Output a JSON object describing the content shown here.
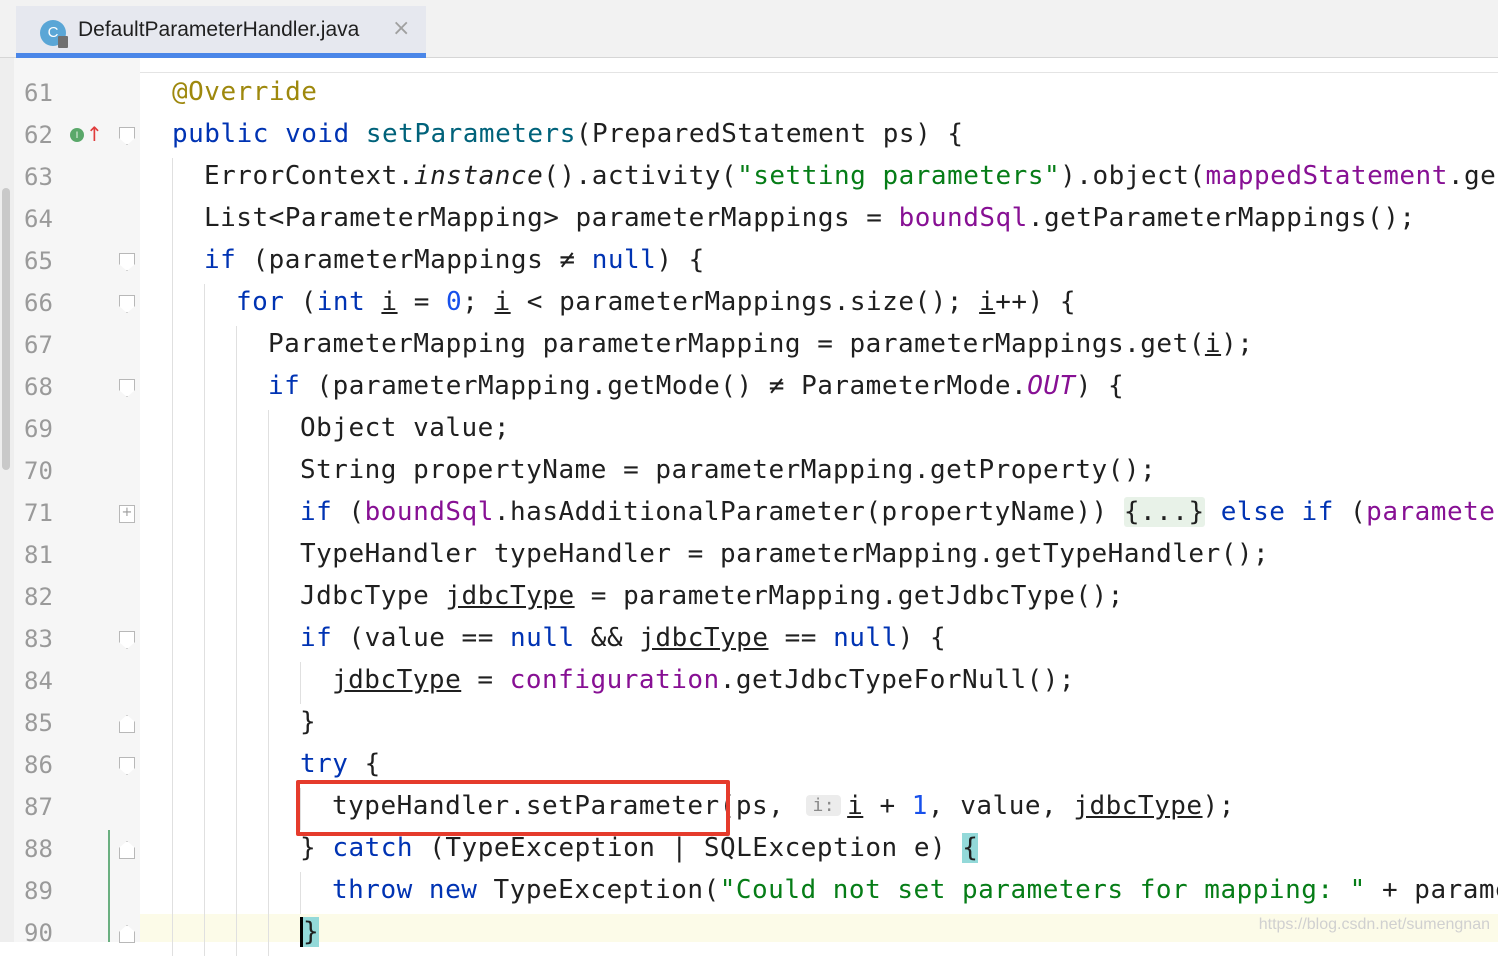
{
  "tab": {
    "file_icon_letter": "C",
    "title": "DefaultParameterHandler.java",
    "close": "×"
  },
  "gutter": {
    "impl_icon": "I",
    "up_arrow": "↑"
  },
  "code_lines": [
    {
      "ln": "61",
      "tokens": [
        {
          "t": "@Override",
          "c": "ann"
        }
      ]
    },
    {
      "ln": "62",
      "tokens": [
        {
          "t": "public ",
          "c": "kw"
        },
        {
          "t": "void ",
          "c": "kw"
        },
        {
          "t": "setParameters",
          "c": "method"
        },
        {
          "t": "(PreparedStatement ps) {",
          "c": ""
        }
      ]
    },
    {
      "ln": "63",
      "tokens": [
        {
          "t": "ErrorContext.",
          "c": ""
        },
        {
          "t": "instance",
          "c": "it"
        },
        {
          "t": "().activity(",
          "c": ""
        },
        {
          "t": "\"setting parameters\"",
          "c": "str"
        },
        {
          "t": ").object(",
          "c": ""
        },
        {
          "t": "mappedStatement",
          "c": "fld"
        },
        {
          "t": ".get",
          "c": ""
        }
      ]
    },
    {
      "ln": "64",
      "tokens": [
        {
          "t": "List<ParameterMapping> parameterMappings = ",
          "c": ""
        },
        {
          "t": "boundSql",
          "c": "fld"
        },
        {
          "t": ".getParameterMappings();",
          "c": ""
        }
      ]
    },
    {
      "ln": "65",
      "tokens": [
        {
          "t": "if ",
          "c": "kw"
        },
        {
          "t": "(parameterMappings ≠ ",
          "c": ""
        },
        {
          "t": "null",
          "c": "kw"
        },
        {
          "t": ") {",
          "c": ""
        }
      ]
    },
    {
      "ln": "66",
      "tokens": [
        {
          "t": "for ",
          "c": "kw"
        },
        {
          "t": "(",
          "c": ""
        },
        {
          "t": "int ",
          "c": "kw"
        },
        {
          "t": "i",
          "c": "ul"
        },
        {
          "t": " = ",
          "c": ""
        },
        {
          "t": "0",
          "c": "num"
        },
        {
          "t": "; ",
          "c": ""
        },
        {
          "t": "i",
          "c": "ul"
        },
        {
          "t": " < parameterMappings.size(); ",
          "c": ""
        },
        {
          "t": "i",
          "c": "ul"
        },
        {
          "t": "++) {",
          "c": ""
        }
      ]
    },
    {
      "ln": "67",
      "tokens": [
        {
          "t": "ParameterMapping parameterMapping = parameterMappings.get(",
          "c": ""
        },
        {
          "t": "i",
          "c": "ul"
        },
        {
          "t": ");",
          "c": ""
        }
      ]
    },
    {
      "ln": "68",
      "tokens": [
        {
          "t": "if ",
          "c": "kw"
        },
        {
          "t": "(parameterMapping.getMode() ≠ ParameterMode.",
          "c": ""
        },
        {
          "t": "OUT",
          "c": "itfld"
        },
        {
          "t": ") {",
          "c": ""
        }
      ]
    },
    {
      "ln": "69",
      "tokens": [
        {
          "t": "Object value;",
          "c": ""
        }
      ]
    },
    {
      "ln": "70",
      "tokens": [
        {
          "t": "String propertyName = parameterMapping.getProperty();",
          "c": ""
        }
      ]
    },
    {
      "ln": "71",
      "tokens": [
        {
          "t": "if ",
          "c": "kw"
        },
        {
          "t": "(",
          "c": ""
        },
        {
          "t": "boundSql",
          "c": "fld"
        },
        {
          "t": ".hasAdditionalParameter(propertyName)) ",
          "c": ""
        },
        {
          "t": "{...}",
          "c": "foldinline"
        },
        {
          "t": " ",
          "c": ""
        },
        {
          "t": "else if ",
          "c": "kw"
        },
        {
          "t": "(",
          "c": ""
        },
        {
          "t": "parameter",
          "c": "fld"
        }
      ]
    },
    {
      "ln": "81",
      "tokens": [
        {
          "t": "TypeHandler typeHandler = parameterMapping.getTypeHandler();",
          "c": ""
        }
      ]
    },
    {
      "ln": "82",
      "tokens": [
        {
          "t": "JdbcType ",
          "c": ""
        },
        {
          "t": "jdbcType",
          "c": "ul"
        },
        {
          "t": " = parameterMapping.getJdbcType();",
          "c": ""
        }
      ]
    },
    {
      "ln": "83",
      "tokens": [
        {
          "t": "if ",
          "c": "kw"
        },
        {
          "t": "(value == ",
          "c": ""
        },
        {
          "t": "null",
          "c": "kw"
        },
        {
          "t": " && ",
          "c": ""
        },
        {
          "t": "jdbcType",
          "c": "ul"
        },
        {
          "t": " == ",
          "c": ""
        },
        {
          "t": "null",
          "c": "kw"
        },
        {
          "t": ") {",
          "c": ""
        }
      ]
    },
    {
      "ln": "84",
      "tokens": [
        {
          "t": "jdbcType",
          "c": "ul"
        },
        {
          "t": " = ",
          "c": ""
        },
        {
          "t": "configuration",
          "c": "fld"
        },
        {
          "t": ".getJdbcTypeForNull();",
          "c": ""
        }
      ]
    },
    {
      "ln": "85",
      "tokens": [
        {
          "t": "}",
          "c": ""
        }
      ]
    },
    {
      "ln": "86",
      "tokens": [
        {
          "t": "try ",
          "c": "kw"
        },
        {
          "t": "{",
          "c": ""
        }
      ]
    },
    {
      "ln": "87",
      "tokens": [
        {
          "t": "typeHandler.setParameter(ps, ",
          "c": ""
        },
        {
          "t": "i:",
          "c": "hint"
        },
        {
          "t": "i",
          "c": "ul"
        },
        {
          "t": " + ",
          "c": ""
        },
        {
          "t": "1",
          "c": "num"
        },
        {
          "t": ", value, ",
          "c": ""
        },
        {
          "t": "jdbcType",
          "c": "ul"
        },
        {
          "t": ");",
          "c": ""
        }
      ]
    },
    {
      "ln": "88",
      "tokens": [
        {
          "t": "} ",
          "c": ""
        },
        {
          "t": "catch ",
          "c": "kw"
        },
        {
          "t": "(TypeException | SQLException e) ",
          "c": ""
        },
        {
          "t": "{",
          "c": "brace"
        }
      ]
    },
    {
      "ln": "89",
      "tokens": [
        {
          "t": "throw ",
          "c": "kw"
        },
        {
          "t": "new ",
          "c": "kw"
        },
        {
          "t": "TypeException(",
          "c": ""
        },
        {
          "t": "\"Could not set parameters for mapping: \"",
          "c": "str"
        },
        {
          "t": " + parame",
          "c": ""
        }
      ]
    },
    {
      "ln": "90",
      "tokens": [
        {
          "t": "}",
          "c": "caretbrace"
        }
      ]
    }
  ],
  "watermark": "https://blog.csdn.net/sumengnan",
  "colors": {
    "keyword": "#0033b3",
    "annotation": "#9e880d",
    "string": "#067d17",
    "field": "#871094",
    "number": "#1750eb",
    "highlight_box": "#e53b2c",
    "tab_underline": "#4a86e8"
  }
}
